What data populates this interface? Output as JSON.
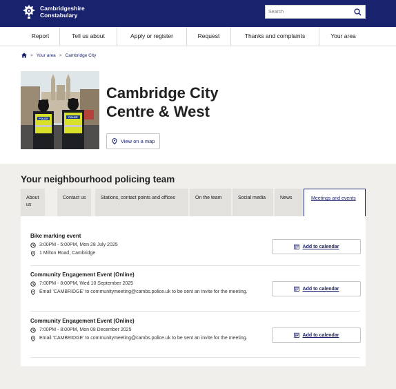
{
  "header": {
    "logo_line1": "Cambridgeshire",
    "logo_line2": "Constabulary",
    "search_placeholder": "Search"
  },
  "nav": [
    {
      "label": "Report"
    },
    {
      "label": "Tell us about"
    },
    {
      "label": "Apply or register"
    },
    {
      "label": "Request"
    },
    {
      "label": "Thanks and complaints"
    },
    {
      "label": "Your area"
    }
  ],
  "breadcrumb": {
    "sep1": ">",
    "item1": "Your area",
    "sep2": ">",
    "item2": "Cambridge City"
  },
  "hero": {
    "title": "Cambridge City Centre & West",
    "map_button": "View on a map",
    "image_badge": "POLICE"
  },
  "team": {
    "title": "Your neighbourhood policing team",
    "tabs": [
      {
        "label": "About us"
      },
      {
        "label": "Contact us"
      },
      {
        "label": "Stations, contact points and offices"
      },
      {
        "label": "On the team"
      },
      {
        "label": "Social media"
      },
      {
        "label": "News"
      },
      {
        "label": "Meetings and events"
      }
    ],
    "active_tab": "Meetings and events"
  },
  "events": [
    {
      "title": "Bike marking event",
      "time": "3:00PM - 5:00PM, Mon 28 July 2025",
      "location": "1 Milton Road, Cambridge",
      "button": "Add to calendar"
    },
    {
      "title": "Community Engagement Event (Online)",
      "time": "7:00PM - 8:00PM, Wed 10 September 2025",
      "location": "Email 'CAMBRIDGE' to communitymeeting@cambs.police.uk to be sent an invite for the meeting.",
      "button": "Add to calendar"
    },
    {
      "title": "Community Engagement Event (Online)",
      "time": "7:00PM - 8:00PM, Mon 08 December 2025",
      "location": "Email 'CAMBRIDGE' to communitymeeting@cambs.police.uk to be sent an invite for the meeting.",
      "button": "Add to calendar"
    }
  ],
  "colors": {
    "brand_navy": "#19226d",
    "section_gray": "#f0efeb",
    "tab_gray": "#e2e1dd"
  }
}
